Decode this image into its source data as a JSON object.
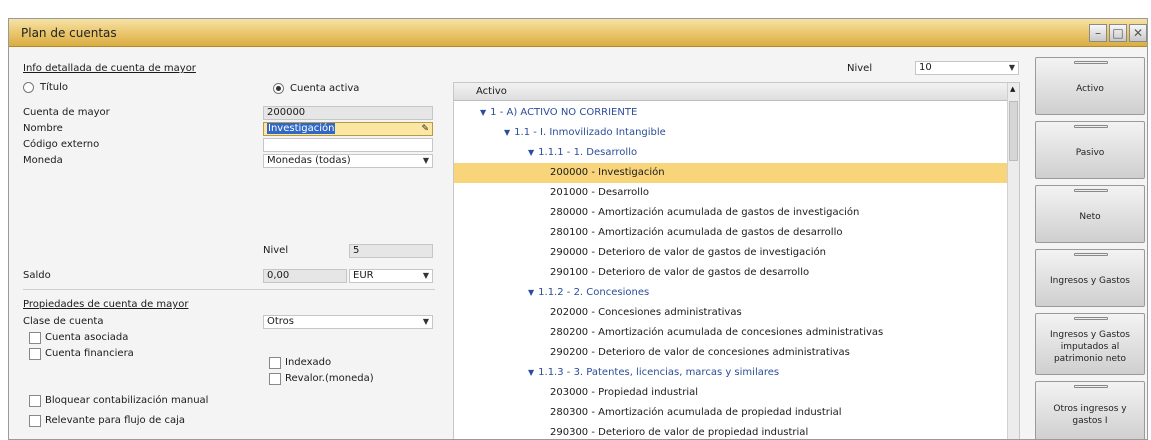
{
  "window": {
    "title": "Plan de cuentas"
  },
  "info": {
    "section_title": "Info detallada de cuenta de mayor",
    "titulo_label": "Título",
    "cuenta_activa_label": "Cuenta activa",
    "cuenta_mayor_label": "Cuenta de mayor",
    "cuenta_mayor_value": "200000",
    "nombre_label": "Nombre",
    "nombre_value": "Investigación",
    "codigo_externo_label": "Código externo",
    "moneda_label": "Moneda",
    "moneda_value": "Monedas (todas)",
    "nivel_label": "Nivel",
    "nivel_value": "5",
    "saldo_label": "Saldo",
    "saldo_value": "0,00",
    "saldo_currency": "EUR"
  },
  "props": {
    "section_title": "Propiedades de cuenta de mayor",
    "clase_label": "Clase de cuenta",
    "clase_value": "Otros",
    "cuenta_asociada": "Cuenta asociada",
    "cuenta_financiera": "Cuenta financiera",
    "indexado": "Indexado",
    "revalor": "Revalor.(moneda)",
    "bloquear": "Bloquear contabilización manual",
    "relevante": "Relevante para flujo de caja"
  },
  "tree": {
    "nivel_label": "Nivel",
    "nivel_value": "10",
    "header": "Activo",
    "rows": [
      {
        "text": "1 - A) ACTIVO NO CORRIENTE"
      },
      {
        "text": "1.1 - I. Inmovilizado Intangible"
      },
      {
        "text": "1.1.1 - 1. Desarrollo"
      },
      {
        "text": "200000 - Investigación"
      },
      {
        "text": "201000 - Desarrollo"
      },
      {
        "text": "280000 - Amortización acumulada de gastos de investigación"
      },
      {
        "text": "280100 - Amortización acumulada de gastos de desarrollo"
      },
      {
        "text": "290000 - Deterioro de valor de gastos de investigación"
      },
      {
        "text": "290100 - Deterioro de valor de gastos de desarrollo"
      },
      {
        "text": "1.1.2 - 2. Concesiones"
      },
      {
        "text": "202000 - Concesiones administrativas"
      },
      {
        "text": "280200 - Amortización acumulada de concesiones administrativas"
      },
      {
        "text": "290200 - Deterioro de valor de concesiones administrativas"
      },
      {
        "text": "1.1.3 - 3. Patentes, licencias, marcas y similares"
      },
      {
        "text": "203000 - Propiedad industrial"
      },
      {
        "text": "280300 - Amortización acumulada de propiedad industrial"
      },
      {
        "text": "290300 - Deterioro de valor de propiedad industrial"
      }
    ]
  },
  "nav": {
    "buttons": [
      {
        "label": "Activo"
      },
      {
        "label": "Pasivo"
      },
      {
        "label": "Neto"
      },
      {
        "label": "Ingresos y Gastos"
      },
      {
        "label_lines": [
          "Ingresos y Gastos",
          "imputados al",
          "patrimonio neto"
        ]
      },
      {
        "label_lines": [
          "Otros ingresos y",
          "gastos I"
        ]
      }
    ]
  },
  "colors": {
    "title_bar": "#e9c46a",
    "highlight_row": "#f8d47a",
    "group_text": "#2b4d9a"
  }
}
